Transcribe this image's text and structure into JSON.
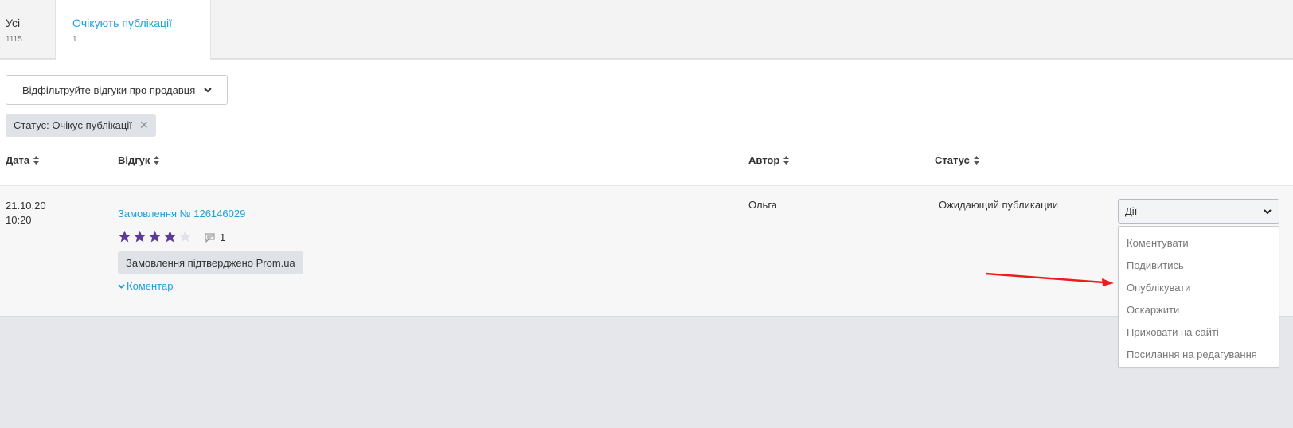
{
  "tabs": [
    {
      "label": "Усі",
      "count": "1115"
    },
    {
      "label": "Очікують публікації",
      "count": "1"
    }
  ],
  "filter": {
    "label": "Відфільтруйте відгуки про продавця"
  },
  "active_filter": {
    "label": "Статус: Очікує публікації"
  },
  "table": {
    "headers": {
      "date": "Дата",
      "review": "Відгук",
      "author": "Автор",
      "status": "Статус"
    },
    "rows": [
      {
        "date": "21.10.20",
        "time": "10:20",
        "order": "Замовлення № 126146029",
        "rating": 4,
        "rating_max": 5,
        "comments": "1",
        "badge": "Замовлення підтверджено Prom.ua",
        "comment_toggle": "Коментар",
        "author": "Ольга",
        "status": "Ожидающий публикации"
      }
    ]
  },
  "actions": {
    "label": "Дії",
    "options": [
      "Коментувати",
      "Подивитись",
      "Опублікувати",
      "Оскаржити",
      "Приховати на сайті",
      "Посилання на редагування"
    ]
  },
  "colors": {
    "link": "#1ea1d8",
    "star_filled": "#5b3b97",
    "star_empty": "#e3e1ee",
    "annotation_arrow": "#ee1c1c"
  }
}
